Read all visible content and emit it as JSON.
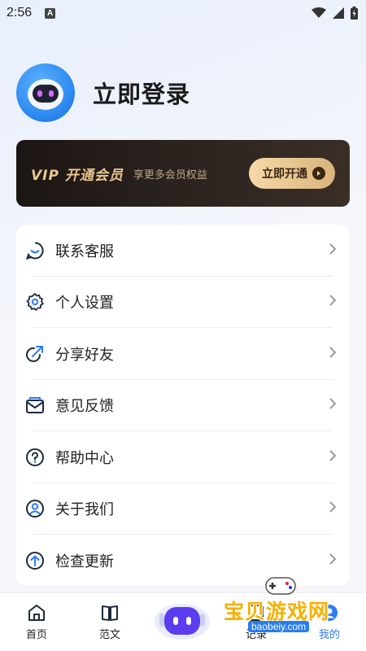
{
  "status_bar": {
    "time": "2:56",
    "notification_letter": "A"
  },
  "profile": {
    "login_text": "立即登录"
  },
  "vip": {
    "title": "VIP 开通会员",
    "subtitle": "享更多会员权益",
    "button_label": "立即开通"
  },
  "menu": {
    "items": [
      {
        "label": "联系客服",
        "icon": "customer-service-icon"
      },
      {
        "label": "个人设置",
        "icon": "gear-icon"
      },
      {
        "label": "分享好友",
        "icon": "share-icon"
      },
      {
        "label": "意见反馈",
        "icon": "feedback-mail-icon"
      },
      {
        "label": "帮助中心",
        "icon": "help-icon"
      },
      {
        "label": "关于我们",
        "icon": "user-icon"
      },
      {
        "label": "检查更新",
        "icon": "update-arrow-icon"
      }
    ]
  },
  "bottom_nav": {
    "items": [
      {
        "label": "首页",
        "icon": "home-icon"
      },
      {
        "label": "范文",
        "icon": "book-icon"
      },
      {
        "label": "",
        "icon": "robot-icon"
      },
      {
        "label": "记录",
        "icon": "record-icon"
      },
      {
        "label": "我的",
        "icon": "profile-icon"
      }
    ]
  },
  "watermark": {
    "text": "宝贝游戏网",
    "url": "baobeiy.com"
  },
  "colors": {
    "accent": "#2f7cf6",
    "vip_gold": "#e9c68f",
    "vip_bg": "#2d2420",
    "icon_dark": "#1d2b3a"
  }
}
